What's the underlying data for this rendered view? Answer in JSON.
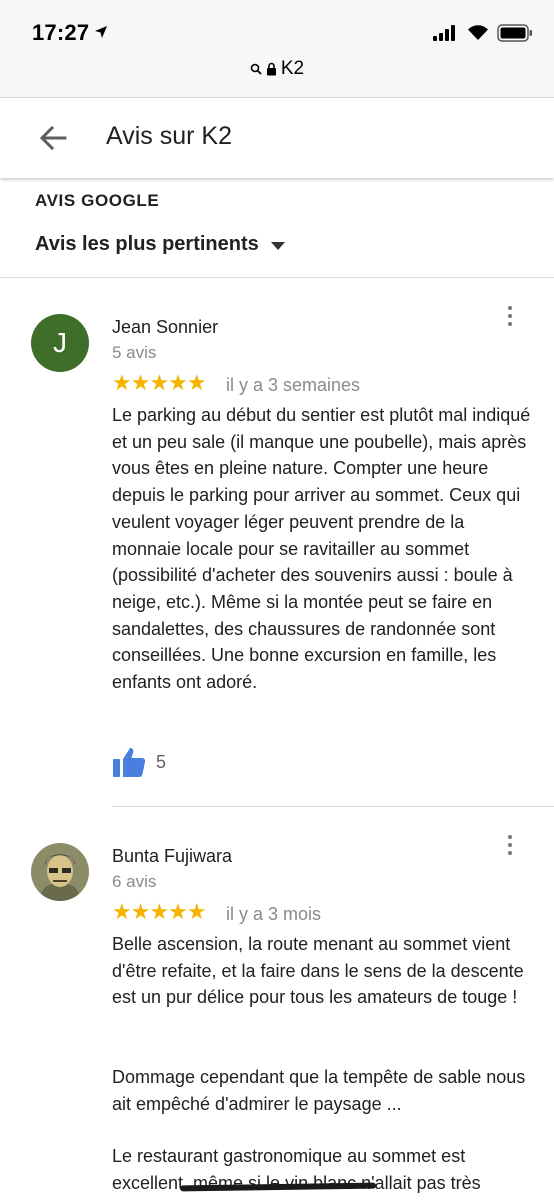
{
  "status_bar": {
    "time": "17:27",
    "location_icon": "location-arrow-icon",
    "signal_icon": "cellular-signal-icon",
    "wifi_icon": "wifi-icon",
    "battery_icon": "battery-icon"
  },
  "url_bar": {
    "text": "K2",
    "icons": [
      "search-icon",
      "lock-icon"
    ]
  },
  "header": {
    "title": "Avis sur K2",
    "back_icon": "back-arrow-icon"
  },
  "section": {
    "label": "AVIS GOOGLE",
    "sort_label": "Avis les plus pertinents"
  },
  "reviews": [
    {
      "name": "Jean Sonnier",
      "avatar_letter": "J",
      "avatar_color": "#3f6e2a",
      "review_count": "5 avis",
      "rating": 5,
      "stars": "★★★★★",
      "date": "il y a 3 semaines",
      "text": "Le parking au début du sentier est plutôt mal indiqué et un peu sale (il manque une poubelle), mais après vous êtes en pleine nature. Compter une heure depuis le parking pour arriver au sommet. Ceux qui veulent voyager léger peuvent prendre  de la monnaie locale pour se ravitailler au sommet (possibilité d'acheter des souvenirs aussi : boule à neige, etc.). Même si la montée peut se faire en sandalettes, des chaussures de randonnée sont conseillées. Une bonne excursion en famille, les enfants ont adoré.",
      "likes": "5"
    },
    {
      "name": "Bunta Fujiwara",
      "review_count": "6 avis",
      "rating": 5,
      "stars": "★★★★★",
      "date": "il y a 3 mois",
      "paragraphs": [
        "Belle ascension, la route menant au sommet vient d'être refaite, et la faire dans le sens de la descente est un pur délice pour tous les amateurs de touge !",
        "Dommage cependant que la tempête de sable nous ait empêché d'admirer le paysage ...",
        "Le restaurant gastronomique au sommet est excellent, même si le vin blanc n'allait pas très"
      ]
    }
  ],
  "colors": {
    "star": "#f4b400",
    "like": "#4a7fe0",
    "meta_gray": "#8a8a8a"
  }
}
